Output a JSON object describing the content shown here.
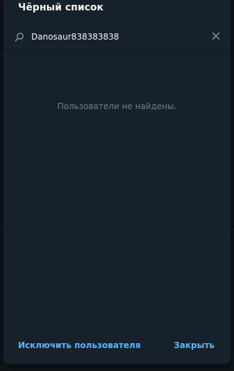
{
  "dialog": {
    "title": "Чёрный список",
    "search": {
      "value": "Danosaur838383838",
      "icon": "search-icon"
    },
    "clear_icon": "close-icon",
    "empty_message": "Пользователи не найдены.",
    "buttons": {
      "exclude_user": "Исключить пользователя",
      "close": "Закрыть"
    }
  },
  "colors": {
    "dialog_bg": "#17212b",
    "accent": "#5eb5f7",
    "muted_text": "#6d7f8f",
    "title_text": "#f5f5f5"
  }
}
